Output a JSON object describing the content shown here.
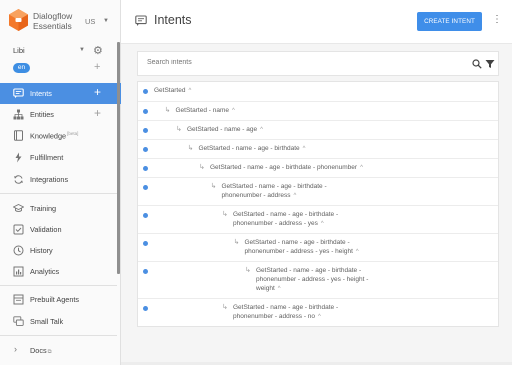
{
  "brand": {
    "line1": "Dialogflow",
    "line2": "Essentials",
    "region": "US",
    "logo_color": "#f3792b"
  },
  "agent": {
    "name": "Libi",
    "language": "en"
  },
  "nav": {
    "intents": "Intents",
    "entities": "Entities",
    "knowledge": "Knowledge",
    "knowledge_badge": "[beta]",
    "fulfillment": "Fulfillment",
    "integrations": "Integrations",
    "training": "Training",
    "validation": "Validation",
    "history": "History",
    "analytics": "Analytics",
    "prebuilt": "Prebuilt Agents",
    "smalltalk": "Small Talk",
    "docs": "Docs"
  },
  "header": {
    "title": "Intents",
    "create_label": "CREATE INTENT"
  },
  "search": {
    "placeholder": "Search intents"
  },
  "intents": [
    {
      "level": 0,
      "lines": [
        "GetStarted"
      ]
    },
    {
      "level": 1,
      "lines": [
        "GetStarted - name"
      ]
    },
    {
      "level": 2,
      "lines": [
        "GetStarted - name - age"
      ]
    },
    {
      "level": 3,
      "lines": [
        "GetStarted - name - age - birthdate"
      ]
    },
    {
      "level": 4,
      "lines": [
        "GetStarted - name - age - birthdate - phonenumber"
      ]
    },
    {
      "level": 5,
      "lines": [
        "GetStarted - name - age - birthdate -",
        "phonenumber - address"
      ]
    },
    {
      "level": 6,
      "lines": [
        "GetStarted - name - age - birthdate -",
        "phonenumber - address - yes"
      ]
    },
    {
      "level": 7,
      "lines": [
        "GetStarted - name - age - birthdate -",
        "phonenumber - address - yes - height"
      ]
    },
    {
      "level": 8,
      "lines": [
        "GetStarted - name - age - birthdate -",
        "phonenumber - address - yes - height -",
        "weight"
      ]
    },
    {
      "level": 6,
      "lines": [
        "GetStarted - name - age - birthdate -",
        "phonenumber - address - no"
      ]
    }
  ],
  "colors": {
    "accent": "#4b8fe2",
    "button": "#3f8ee9"
  }
}
